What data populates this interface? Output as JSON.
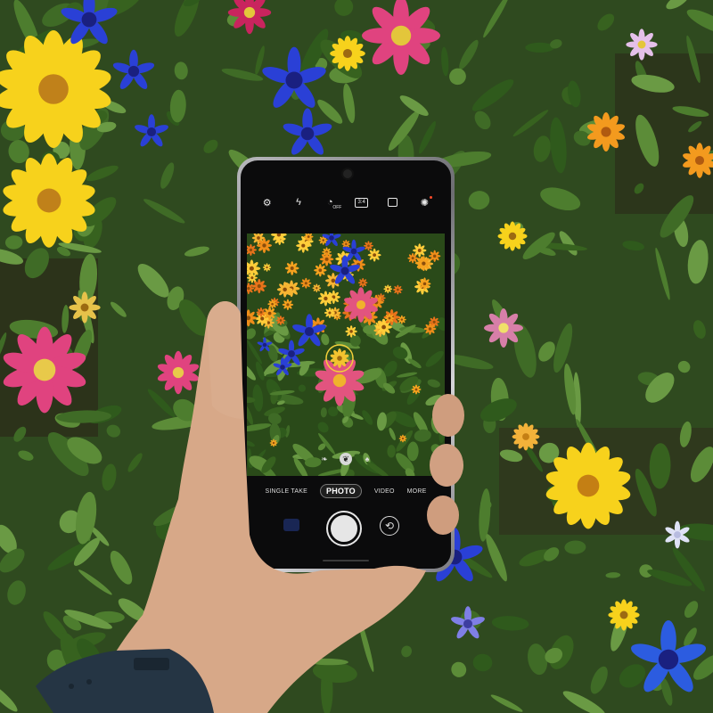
{
  "camera_app": {
    "top_icons": [
      "settings-icon",
      "flash-off-icon",
      "timer-off-icon",
      "aspect-ratio-icon",
      "motion-photo-icon",
      "effects-icon"
    ],
    "timer_label": "OFF",
    "ratio_label": "3:4",
    "modes": [
      "SINGLE TAKE",
      "PHOTO",
      "VIDEO",
      "MORE"
    ],
    "active_mode": "PHOTO"
  },
  "colors": {
    "phone_frame": "#9c9ca0",
    "screen": "#0b0b0c",
    "foliage": "#2f4a1f",
    "yellow_flower": "#f7d21c",
    "blue_flower": "#2a40d6",
    "pink_flower": "#e0437f",
    "orange_flower": "#f39a1e",
    "watch_band": "#253544"
  }
}
